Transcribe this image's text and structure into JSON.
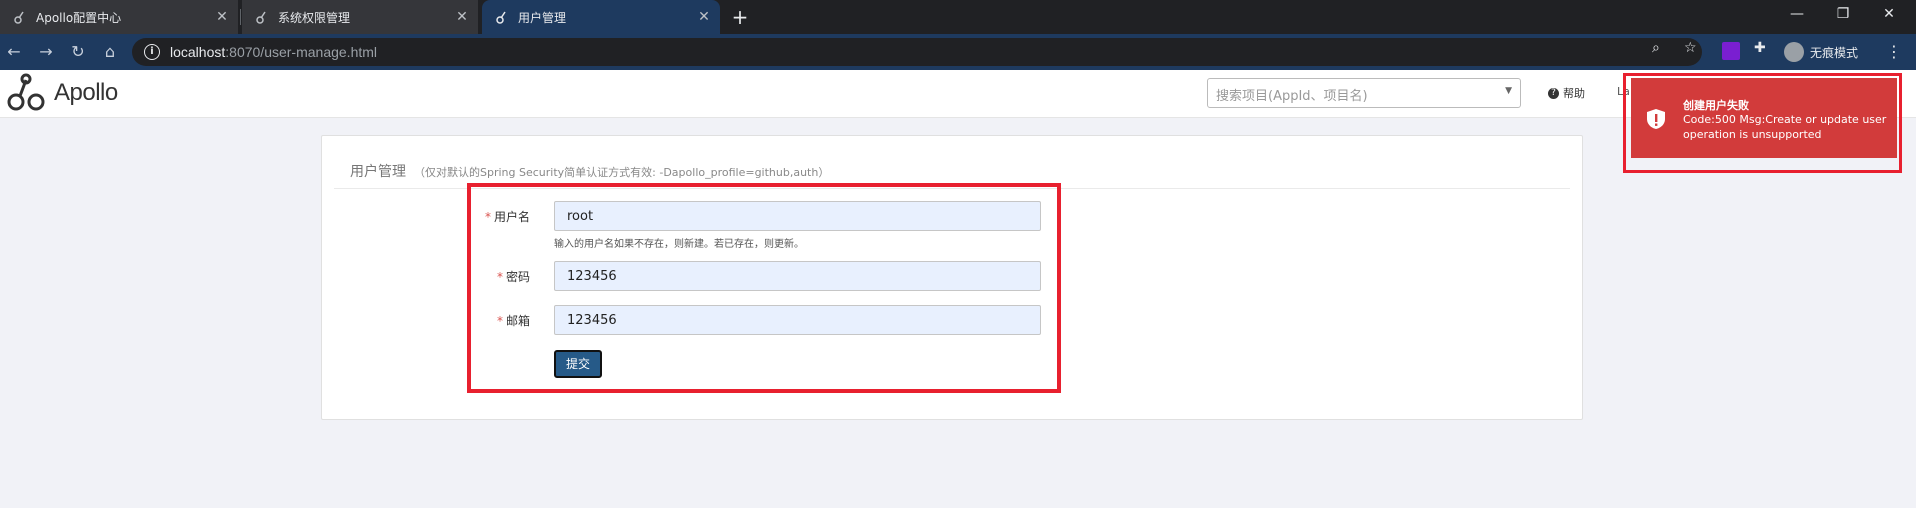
{
  "browser": {
    "tabs": [
      {
        "title": "Apollo配置中心"
      },
      {
        "title": "系统权限管理"
      },
      {
        "title": "用户管理"
      }
    ],
    "url_host": "localhost",
    "url_rest": ":8070/user-manage.html",
    "profile_label": "无痕模式"
  },
  "app": {
    "logo_text": "Apollo",
    "search_placeholder": "搜索项目(AppId、项目名)",
    "help_label": "帮助",
    "cut_label": "La"
  },
  "toast": {
    "title": "创建用户失败",
    "message": "Code:500 Msg:Create or update user operation is unsupported"
  },
  "panel": {
    "title": "用户管理",
    "note": "（仅对默认的Spring Security简单认证方式有效: -Dapollo_profile=github,auth）"
  },
  "form": {
    "username_label": "用户名",
    "username_value": "root",
    "username_help": "输入的用户名如果不存在，则新建。若已存在，则更新。",
    "password_label": "密码",
    "password_value": "123456",
    "email_label": "邮箱",
    "email_value": "123456",
    "required_mark": "*",
    "submit_label": "提交"
  },
  "colors": {
    "toolbar": "#1e3a5f",
    "toast": "#d23b3b",
    "highlight": "#e8202f",
    "submit": "#265a88"
  }
}
